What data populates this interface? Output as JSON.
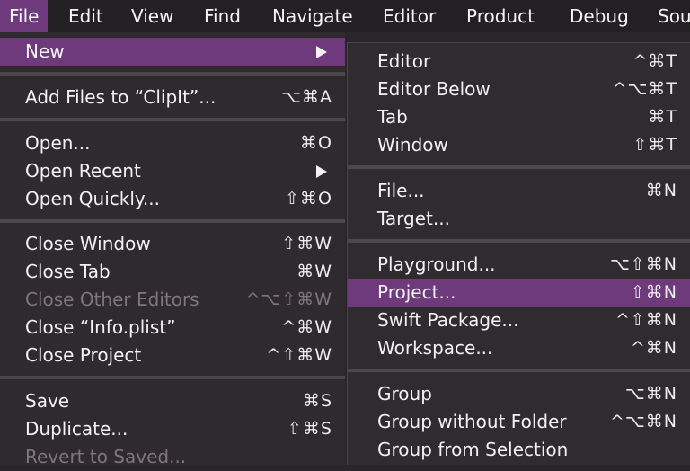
{
  "menubar": {
    "items": [
      "File",
      "Edit",
      "View",
      "Find",
      "Navigate",
      "Editor",
      "Product",
      "Debug",
      "Sou"
    ]
  },
  "file_menu": {
    "items": [
      {
        "label": "New",
        "shortcut": "",
        "submenu": true
      },
      {
        "label": "Add Files to “ClipIt”...",
        "shortcut": "⌥⌘A"
      },
      {
        "label": "Open...",
        "shortcut": "⌘O"
      },
      {
        "label": "Open Recent",
        "shortcut": "",
        "submenu": true
      },
      {
        "label": "Open Quickly...",
        "shortcut": "⇧⌘O"
      },
      {
        "label": "Close Window",
        "shortcut": "⇧⌘W"
      },
      {
        "label": "Close Tab",
        "shortcut": "⌘W"
      },
      {
        "label": "Close Other Editors",
        "shortcut": "^⌥⇧⌘W",
        "disabled": true
      },
      {
        "label": "Close “Info.plist”",
        "shortcut": "^⌘W"
      },
      {
        "label": "Close Project",
        "shortcut": "^⇧⌘W"
      },
      {
        "label": "Save",
        "shortcut": "⌘S"
      },
      {
        "label": "Duplicate...",
        "shortcut": "⇧⌘S"
      },
      {
        "label": "Revert to Saved...",
        "shortcut": "",
        "disabled": true
      }
    ]
  },
  "new_submenu": {
    "items": [
      {
        "label": "Editor",
        "shortcut": "^⌘T"
      },
      {
        "label": "Editor Below",
        "shortcut": "^⌥⌘T"
      },
      {
        "label": "Tab",
        "shortcut": "⌘T"
      },
      {
        "label": "Window",
        "shortcut": "⇧⌘T"
      },
      {
        "label": "File...",
        "shortcut": "⌘N"
      },
      {
        "label": "Target...",
        "shortcut": ""
      },
      {
        "label": "Playground...",
        "shortcut": "⌥⇧⌘N"
      },
      {
        "label": "Project...",
        "shortcut": "⇧⌘N"
      },
      {
        "label": "Swift Package...",
        "shortcut": "^⇧⌘N"
      },
      {
        "label": "Workspace...",
        "shortcut": "^⌘N"
      },
      {
        "label": "Group",
        "shortcut": "⌥⌘N"
      },
      {
        "label": "Group without Folder",
        "shortcut": "^⌥⌘N"
      },
      {
        "label": "Group from Selection",
        "shortcut": ""
      }
    ]
  },
  "colors": {
    "highlight": "#6e3a7c",
    "menu_bg": "#2f2a2e",
    "separator": "#4c474b"
  }
}
